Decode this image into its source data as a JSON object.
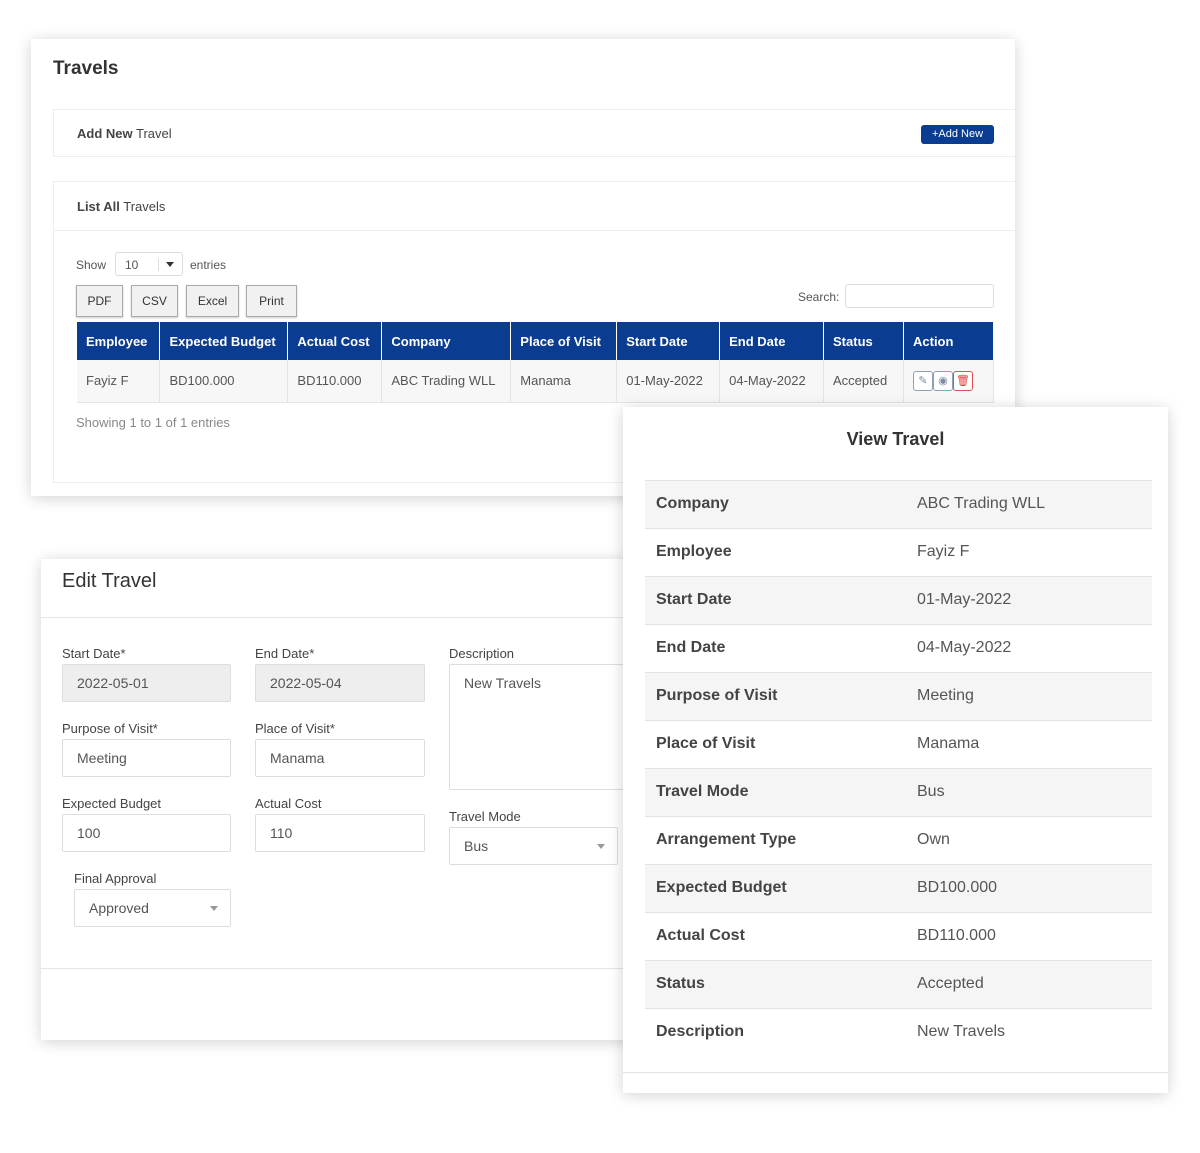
{
  "travels": {
    "title": "Travels",
    "add_card": {
      "title_bold": "Add New",
      "title_rest": " Travel",
      "add_button": "Add New",
      "add_icon": "plus-icon"
    },
    "list_card": {
      "title_bold": "List All",
      "title_rest": " Travels",
      "show_label": "Show",
      "page_size": "10",
      "entries_label": "entries",
      "export_buttons": [
        "PDF",
        "CSV",
        "Excel",
        "Print"
      ],
      "search_label": "Search:",
      "search_value": "",
      "columns": [
        "Employee",
        "Expected Budget",
        "Actual Cost",
        "Company",
        "Place of Visit",
        "Start Date",
        "End Date",
        "Status",
        "Action"
      ],
      "rows": [
        [
          "Fayiz F",
          "BD100.000",
          "BD110.000",
          "ABC Trading WLL",
          "Manama",
          "01-May-2022",
          "04-May-2022",
          "Accepted"
        ]
      ],
      "footer": "Showing 1 to 1 of 1 entries"
    }
  },
  "edit": {
    "title": "Edit Travel",
    "start_date": {
      "label": "Start Date*",
      "value": "2022-05-01"
    },
    "end_date": {
      "label": "End Date*",
      "value": "2022-05-04"
    },
    "description": {
      "label": "Description",
      "value": "New Travels"
    },
    "purpose": {
      "label": "Purpose of Visit*",
      "value": "Meeting"
    },
    "place": {
      "label": "Place of Visit*",
      "value": "Manama"
    },
    "expected_budget": {
      "label": "Expected Budget",
      "value": "100"
    },
    "actual_cost": {
      "label": "Actual Cost",
      "value": "110"
    },
    "travel_mode": {
      "label": "Travel Mode",
      "value": "Bus"
    },
    "final_approval": {
      "label": "Final Approval",
      "value": "Approved"
    }
  },
  "view": {
    "title": "View Travel",
    "rows": [
      {
        "k": "Company",
        "v": "ABC Trading WLL"
      },
      {
        "k": "Employee",
        "v": "Fayiz F"
      },
      {
        "k": "Start Date",
        "v": "01-May-2022"
      },
      {
        "k": "End Date",
        "v": "04-May-2022"
      },
      {
        "k": "Purpose of Visit",
        "v": "Meeting"
      },
      {
        "k": "Place of Visit",
        "v": "Manama"
      },
      {
        "k": "Travel Mode",
        "v": "Bus"
      },
      {
        "k": "Arrangement Type",
        "v": "Own"
      },
      {
        "k": "Expected Budget",
        "v": "BD100.000"
      },
      {
        "k": "Actual Cost",
        "v": "BD110.000"
      },
      {
        "k": "Status",
        "v": "Accepted"
      },
      {
        "k": "Description",
        "v": "New Travels"
      }
    ]
  },
  "colors": {
    "primary": "#0a3d91",
    "danger": "#e03a3a"
  }
}
